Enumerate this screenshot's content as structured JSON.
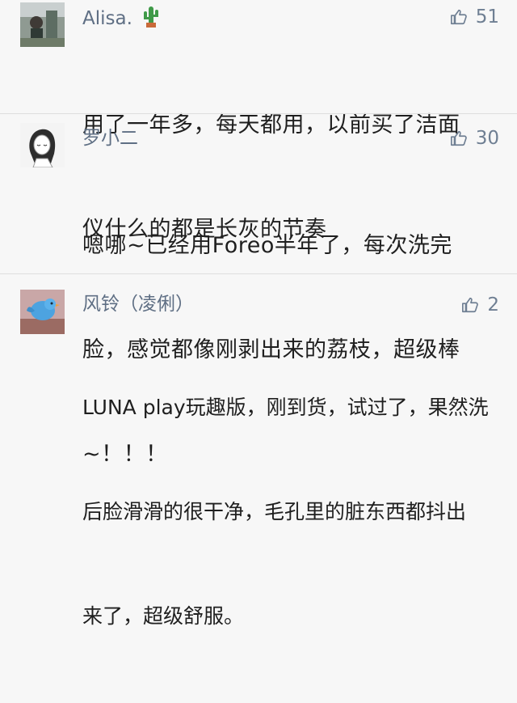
{
  "comments": [
    {
      "name": "Alisa.",
      "name_icon": "cactus-icon",
      "likes": "51",
      "lines": [
        "用了一年多，每天都用，以前买了洁面",
        "仪什么的都是长灰的节奏"
      ]
    },
    {
      "name": "罗小二",
      "likes": "30",
      "lines": [
        "嗯哪~已经用Foreo半年了，每次洗完",
        "脸，感觉都像刚剥出来的荔枝，超级棒",
        "~！！！"
      ]
    },
    {
      "name": "风铃（凌俐）",
      "likes": "2",
      "lines": [
        "LUNA play玩趣版，刚到货，试过了，果然洗",
        "后脸滑滑的很干净，毛孔里的脏东西都抖出",
        "来了，超级舒服。"
      ]
    }
  ],
  "colors": {
    "background": "#f7f7f7",
    "name": "#5f6f84",
    "like": "#6f7f93",
    "text": "#1f1f1f"
  },
  "icons": [
    "thumbs-up-icon",
    "cactus-icon"
  ]
}
